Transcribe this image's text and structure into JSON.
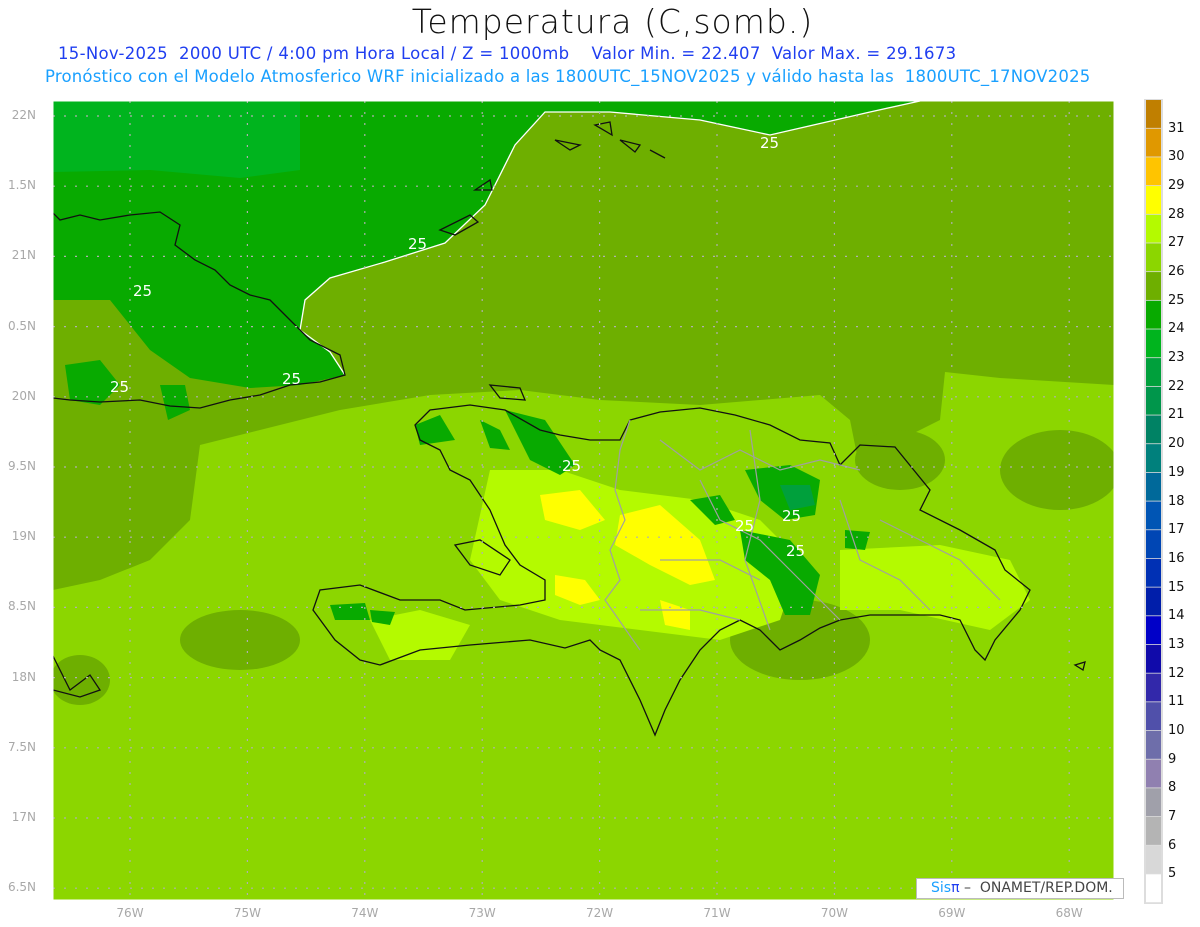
{
  "header": {
    "title": "Temperatura (C,somb.)",
    "subtitle_line1": "15-Nov-2025  2000 UTC / 4:00 pm Hora Local / Z = 1000mb    Valor Min. = 22.407  Valor Max. = 29.1673",
    "subtitle_line2": "Pronóstico con el Modelo Atmosferico WRF inicializado a las 1800UTC_15NOV2025 y válido hasta las  1800UTC_17NOV2025"
  },
  "axes": {
    "lat_labels": [
      "22N",
      "1.5N",
      "21N",
      "0.5N",
      "20N",
      "9.5N",
      "19N",
      "8.5N",
      "18N",
      "7.5N",
      "17N",
      "6.5N"
    ],
    "lon_labels": [
      "76W",
      "75W",
      "74W",
      "73W",
      "72W",
      "71W",
      "70W",
      "69W",
      "68W"
    ]
  },
  "contours": {
    "label": "25"
  },
  "colorbar": {
    "labels": [
      "31",
      "30",
      "29",
      "28",
      "27",
      "26",
      "25",
      "24",
      "23",
      "22",
      "21",
      "20",
      "19",
      "18",
      "17",
      "16",
      "15",
      "14",
      "13",
      "12",
      "11",
      "10",
      "9",
      "8",
      "7",
      "6",
      "5"
    ],
    "colors": [
      "#c07f00",
      "#e09800",
      "#ffc400",
      "#ffff00",
      "#b4fa00",
      "#8cd600",
      "#6eaf00",
      "#08aa00",
      "#00b41e",
      "#00a03c",
      "#00964b",
      "#008264",
      "#00807c",
      "#00699a",
      "#0055b4",
      "#0046b4",
      "#0030b4",
      "#001eaa",
      "#0000c8",
      "#100aaa",
      "#3228aa",
      "#5050aa",
      "#6e6eaa",
      "#9080b0",
      "#a0a0aa",
      "#b4b4b4",
      "#d8d8d8",
      "#ffffff"
    ]
  },
  "credit": {
    "sis": "Sis",
    "pi": "π",
    "org": " –  ONAMET/REP.DOM."
  }
}
